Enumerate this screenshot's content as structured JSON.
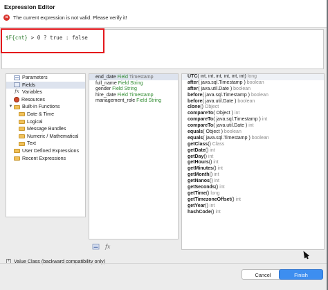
{
  "window": {
    "title": "Expression Editor",
    "error_message": "The current expression is not valid. Please verify it!"
  },
  "editor": {
    "expression_parts": {
      "field": "$F{cnt}",
      "rest": " > 0 ? true : false"
    }
  },
  "tree": {
    "items": [
      {
        "label": "Parameters",
        "icon": "parameters-icon",
        "level": 0
      },
      {
        "label": "Fields",
        "icon": "fields-icon",
        "level": 0
      },
      {
        "label": "Variables",
        "icon": "variables-fx-icon",
        "level": 0
      },
      {
        "label": "Resources",
        "icon": "resources-icon",
        "level": 0
      },
      {
        "label": "Built-in Functions",
        "icon": "folder-icon",
        "level": 0,
        "expander": "▼"
      },
      {
        "label": "Date & Time",
        "icon": "folder-icon",
        "level": 1
      },
      {
        "label": "Logical",
        "icon": "folder-icon",
        "level": 1
      },
      {
        "label": "Message Bundles",
        "icon": "folder-icon",
        "level": 1
      },
      {
        "label": "Numeric / Mathematical",
        "icon": "folder-icon",
        "level": 1
      },
      {
        "label": "Text",
        "icon": "folder-icon",
        "level": 1
      },
      {
        "label": "User Defined Expressions",
        "icon": "folder-icon",
        "level": 0
      },
      {
        "label": "Recent Expressions",
        "icon": "folder-icon",
        "level": 0
      }
    ]
  },
  "fields": [
    {
      "name": "end_date",
      "kw": "Field",
      "type": "Timestamp"
    },
    {
      "name": "full_name",
      "kw": "Field",
      "type": "String"
    },
    {
      "name": "gender",
      "kw": "Field",
      "type": "String"
    },
    {
      "name": "hire_date",
      "kw": "Field",
      "type": "Timestamp"
    },
    {
      "name": "management_role",
      "kw": "Field",
      "type": "String"
    }
  ],
  "methods": [
    {
      "name": "UTC",
      "args": "( int, int, int, int, int, int)",
      "ret": "long"
    },
    {
      "name": "after",
      "args": "( java.sql.Timestamp )",
      "ret": "boolean"
    },
    {
      "name": "after",
      "args": "( java.util.Date )",
      "ret": "boolean"
    },
    {
      "name": "before",
      "args": "( java.sql.Timestamp )",
      "ret": "boolean"
    },
    {
      "name": "before",
      "args": "( java.util.Date )",
      "ret": "boolean"
    },
    {
      "name": "clone",
      "args": "()",
      "ret": "Object"
    },
    {
      "name": "compareTo",
      "args": "( Object )",
      "ret": "int"
    },
    {
      "name": "compareTo",
      "args": "( java.sql.Timestamp )",
      "ret": "int"
    },
    {
      "name": "compareTo",
      "args": "( java.util.Date )",
      "ret": "int"
    },
    {
      "name": "equals",
      "args": "( Object )",
      "ret": "boolean"
    },
    {
      "name": "equals",
      "args": "( java.sql.Timestamp )",
      "ret": "boolean"
    },
    {
      "name": "getClass",
      "args": "()",
      "ret": "Class"
    },
    {
      "name": "getDate",
      "args": "()",
      "ret": "int"
    },
    {
      "name": "getDay",
      "args": "()",
      "ret": "int"
    },
    {
      "name": "getHours",
      "args": "()",
      "ret": "int"
    },
    {
      "name": "getMinutes",
      "args": "()",
      "ret": "int"
    },
    {
      "name": "getMonth",
      "args": "()",
      "ret": "int"
    },
    {
      "name": "getNanos",
      "args": "()",
      "ret": "int"
    },
    {
      "name": "getSeconds",
      "args": "()",
      "ret": "int"
    },
    {
      "name": "getTime",
      "args": "()",
      "ret": "long"
    },
    {
      "name": "getTimezoneOffset",
      "args": "()",
      "ret": "int"
    },
    {
      "name": "getYear",
      "args": "()",
      "ret": "int"
    },
    {
      "name": "hashCode",
      "args": "()",
      "ret": "int"
    }
  ],
  "value_class": {
    "toggle": "+",
    "label": "Value Class (backward compatibility only)"
  },
  "buttons": {
    "cancel": "Cancel",
    "finish": "Finish"
  },
  "colors": {
    "accent": "#3d8ef0",
    "error": "#d8322c",
    "highlight": "#e4161b"
  }
}
